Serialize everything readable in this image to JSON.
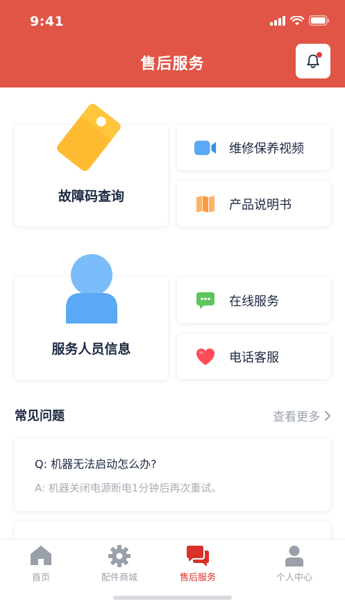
{
  "status_bar": {
    "time": "9:41"
  },
  "header": {
    "title": "售后服务"
  },
  "main": {
    "fault_code": {
      "label": "故障码查询"
    },
    "repair_video": {
      "label": "维修保养视频"
    },
    "manual": {
      "label": "产品说明书"
    },
    "staff_info": {
      "label": "服务人员信息"
    },
    "online_service": {
      "label": "在线服务"
    },
    "phone_service": {
      "label": "电话客服"
    }
  },
  "faq": {
    "title": "常见问题",
    "see_more": "查看更多",
    "items": [
      {
        "q": "Q: 机器无法启动怎么办?",
        "a": "A: 机器关闭电源断电1分钟后再次重试。"
      }
    ]
  },
  "tabbar": {
    "items": [
      {
        "label": "首页",
        "icon": "home-icon"
      },
      {
        "label": "配件商城",
        "icon": "gear-icon"
      },
      {
        "label": "售后服务",
        "icon": "chat-icon",
        "active": true
      },
      {
        "label": "个人中心",
        "icon": "person-icon"
      }
    ]
  },
  "colors": {
    "brand": "#e05546",
    "active_tab": "#d9302a",
    "tag_yellow": "#ffc53d",
    "person_blue": "#5aa9f5"
  }
}
